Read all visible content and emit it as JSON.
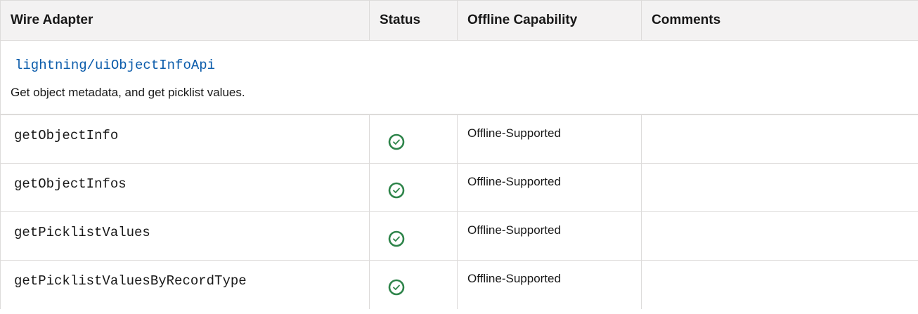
{
  "table": {
    "headers": [
      "Wire Adapter",
      "Status",
      "Offline Capability",
      "Comments"
    ],
    "group": {
      "link": "lightning/uiObjectInfoApi",
      "description": "Get object metadata, and get picklist values."
    },
    "rows": [
      {
        "name": "getObjectInfo",
        "status_icon": "check-circle-icon",
        "capability": "Offline-Supported",
        "comments": ""
      },
      {
        "name": "getObjectInfos",
        "status_icon": "check-circle-icon",
        "capability": "Offline-Supported",
        "comments": ""
      },
      {
        "name": "getPicklistValues",
        "status_icon": "check-circle-icon",
        "capability": "Offline-Supported",
        "comments": ""
      },
      {
        "name": "getPicklistValuesByRecordType",
        "status_icon": "check-circle-icon",
        "capability": "Offline-Supported",
        "comments": ""
      }
    ],
    "colors": {
      "header_bg": "#f3f2f2",
      "border": "#dddbda",
      "link": "#0b5cab",
      "check": "#2e844a"
    }
  }
}
